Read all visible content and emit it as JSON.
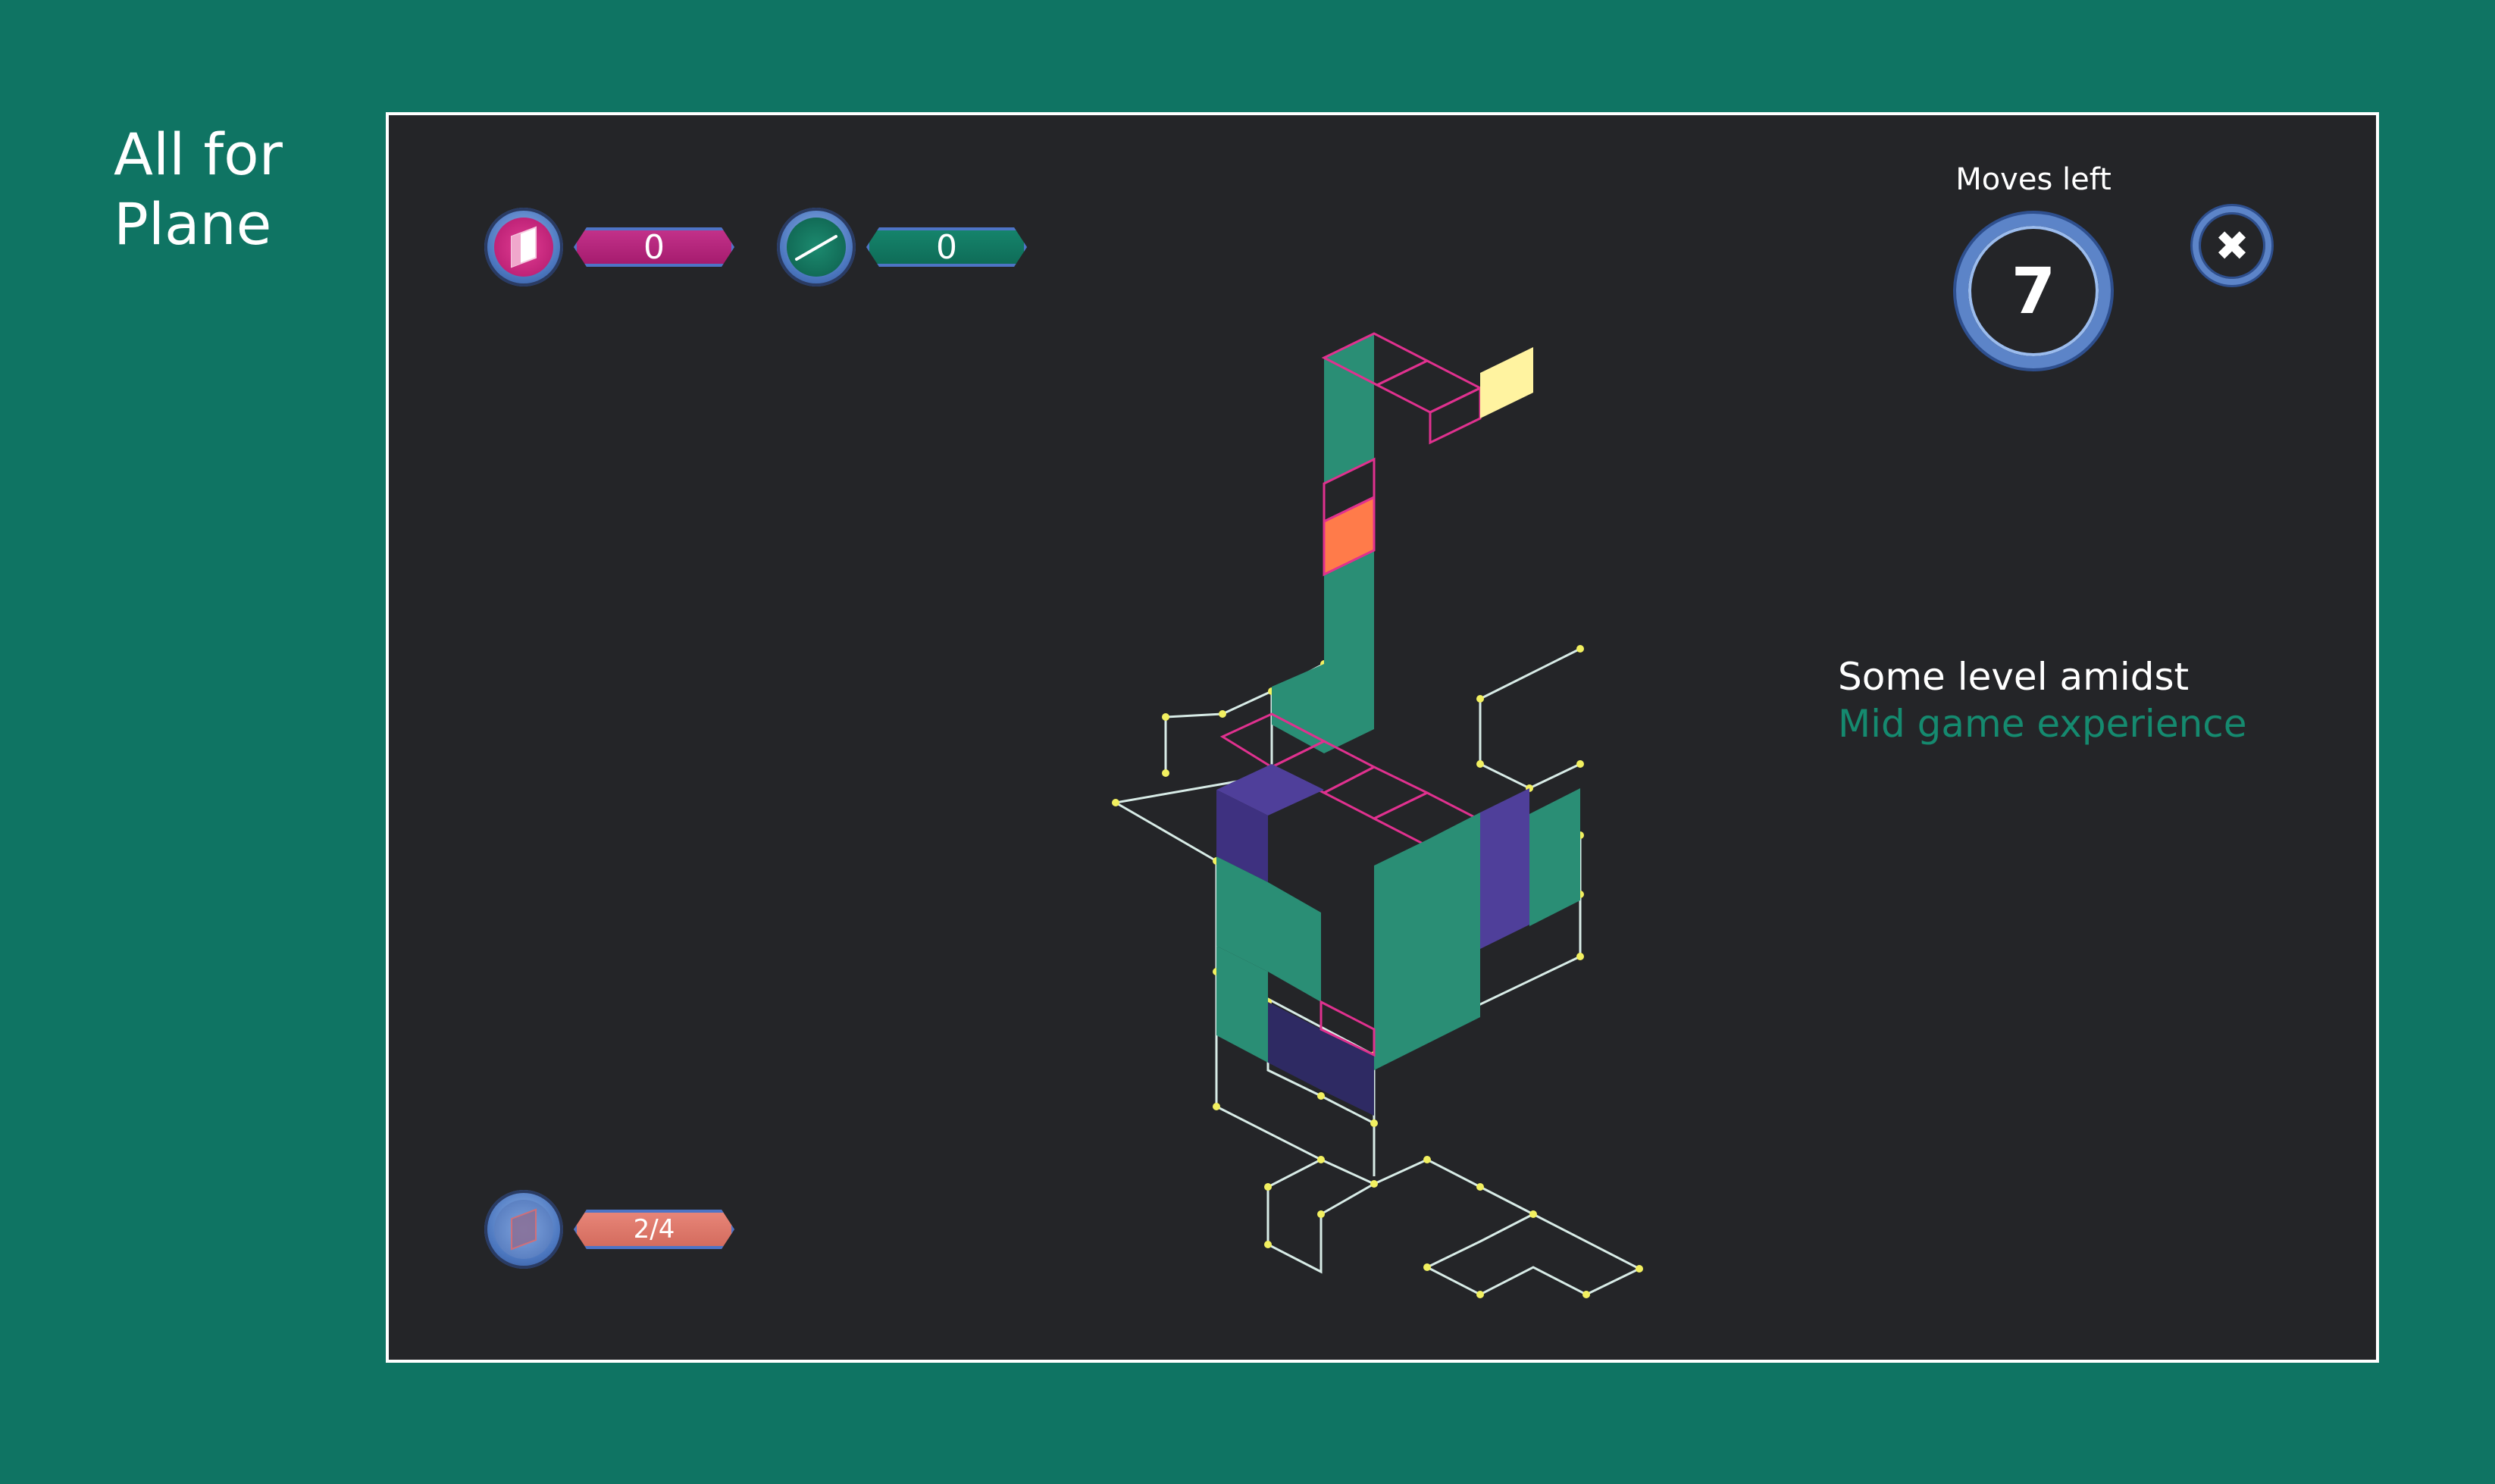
{
  "page_title": {
    "line1": "All for",
    "line2": "Plane"
  },
  "hud": {
    "planes_count": "0",
    "lines_count": "0",
    "progress": "2/4",
    "moves_label": "Moves left",
    "moves_value": "7",
    "close_symbol": "✖"
  },
  "icons": {
    "planes": "plane-icon",
    "lines": "line-icon",
    "progress": "plane-progress-icon",
    "close": "close-icon"
  },
  "level": {
    "title": "Some level amidst",
    "subtitle": "Mid game experience"
  },
  "colors": {
    "background": "#0f7463",
    "board": "#242528",
    "teal_face": "#2a8e75",
    "purple_face": "#4f3f9a",
    "magenta_outline": "#e0318f",
    "yellow_tile": "#fff3a0",
    "orange_tile": "#ff7b4a",
    "wire": "#d8ece7"
  }
}
